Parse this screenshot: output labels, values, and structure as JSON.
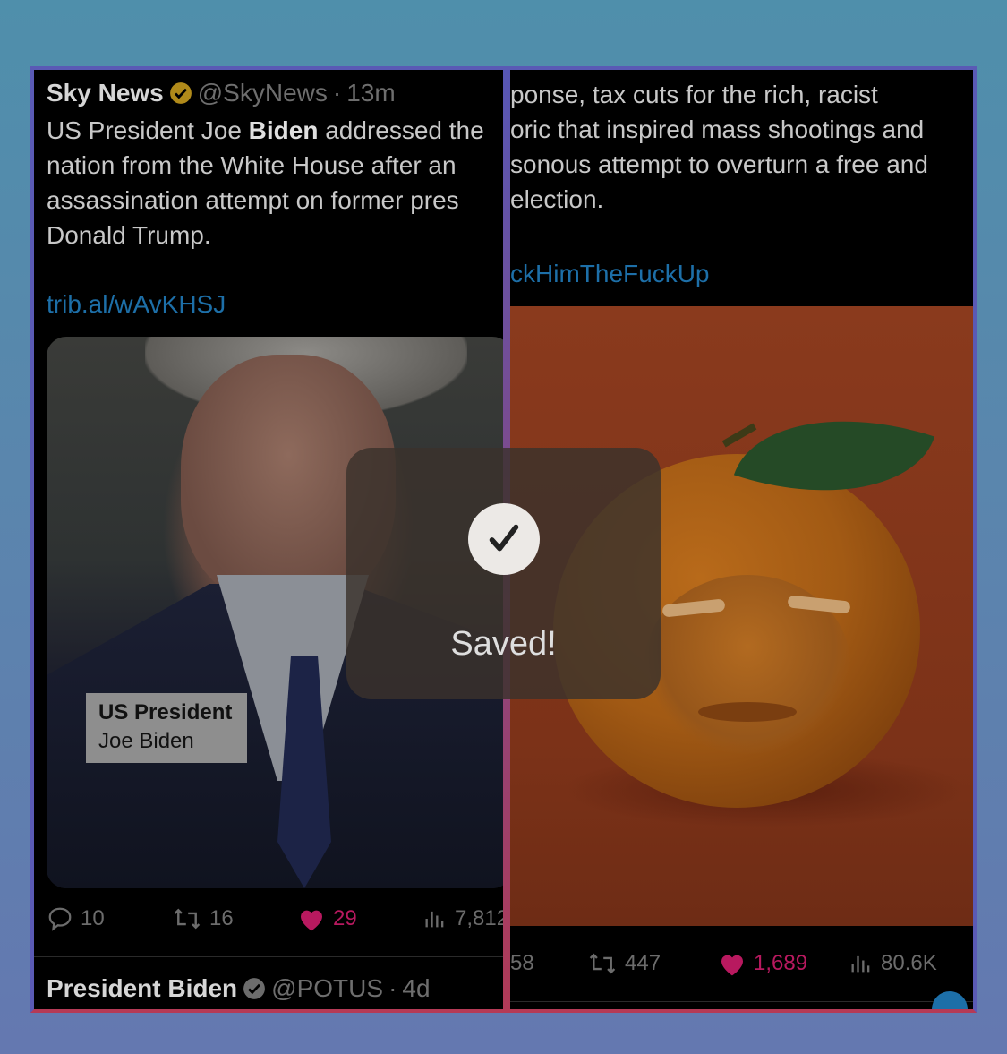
{
  "left_tweet": {
    "author": "Sky News",
    "handle": "@SkyNews",
    "time": "13m",
    "text_line1_pre": "US President Joe ",
    "text_line1_bold": "Biden",
    "text_line1_post": " addressed the",
    "text_line2": "nation from the White House after an",
    "text_line3": "assassination attempt on former pres",
    "text_line4": "Donald Trump.",
    "link": "trib.al/wAvKHSJ",
    "chyron_title": "US President",
    "chyron_name": "Joe Biden",
    "replies": "10",
    "reposts": "16",
    "likes": "29",
    "views": "7,812"
  },
  "next_tweet": {
    "author": "President Biden",
    "handle": "@POTUS",
    "time": "4d"
  },
  "right_tweet": {
    "text_line1": "ponse, tax cuts for the rich, racist",
    "text_line2": "oric that inspired mass shootings and",
    "text_line3": "sonous attempt to overturn a free and",
    "text_line4": "election.",
    "hashtag": "ckHimTheFuckUp",
    "replies": "58",
    "reposts": "447",
    "likes": "1,689",
    "views": "80.6K"
  },
  "toast": {
    "label": "Saved!"
  },
  "colors": {
    "link": "#1d6fa8",
    "like": "#b8195f",
    "verified": "#b08a1a"
  }
}
